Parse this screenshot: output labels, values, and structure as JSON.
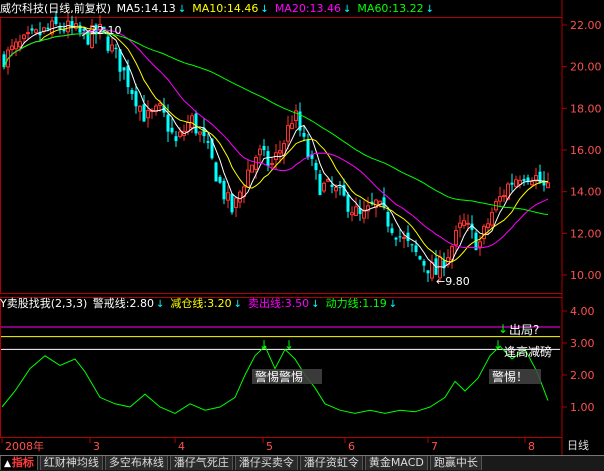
{
  "header": {
    "title": "威尔科技(日线,前复权)",
    "ma": [
      {
        "label": "MA5:14.13",
        "color": "#ffffff"
      },
      {
        "label": "MA10:14.46",
        "color": "#ffff00"
      },
      {
        "label": "MA20:13.46",
        "color": "#ff00ff"
      },
      {
        "label": "MA60:13.22",
        "color": "#00ff00"
      }
    ]
  },
  "indicator": {
    "name": "Y卖股找我(2,3,3)",
    "lines": [
      {
        "label": "警戒线:2.80",
        "color": "#ffffff"
      },
      {
        "label": "减仓线:3.20",
        "color": "#ffff00"
      },
      {
        "label": "卖出线:3.50",
        "color": "#ff00ff"
      },
      {
        "label": "动力线:1.19",
        "color": "#00ff00"
      }
    ],
    "annotations": {
      "exit": "出局?",
      "rally_sell": "逢高减磅",
      "alert_double": "警惕警惕",
      "alert_single": "警惕！"
    }
  },
  "price_axis": [
    "22.00",
    "20.00",
    "18.00",
    "16.00",
    "14.00",
    "12.00",
    "10.00"
  ],
  "indicator_axis": [
    "4.00",
    "3.00",
    "2.00",
    "1.00"
  ],
  "time_axis": {
    "labels": [
      "2008年",
      "3",
      "4",
      "5",
      "6",
      "7",
      "8"
    ],
    "period": "日线"
  },
  "price_marks": {
    "high": "22.10",
    "low": "9.80"
  },
  "tabs": [
    {
      "label": "指标",
      "active": true
    },
    {
      "label": "红财神均线",
      "active": false
    },
    {
      "label": "多空布林线",
      "active": false
    },
    {
      "label": "潘仔气死庄",
      "active": false
    },
    {
      "label": "潘仔买卖令",
      "active": false
    },
    {
      "label": "潘仔资虹令",
      "active": false
    },
    {
      "label": "黄金MACD",
      "active": false
    },
    {
      "label": "跑赢中长",
      "active": false
    }
  ],
  "colors": {
    "background": "#000000",
    "frame": "#b00000",
    "candle_up": "#ff3030",
    "candle_down": "#00ffff",
    "title": "#ffffff",
    "axis_text": "#ff5050"
  }
}
